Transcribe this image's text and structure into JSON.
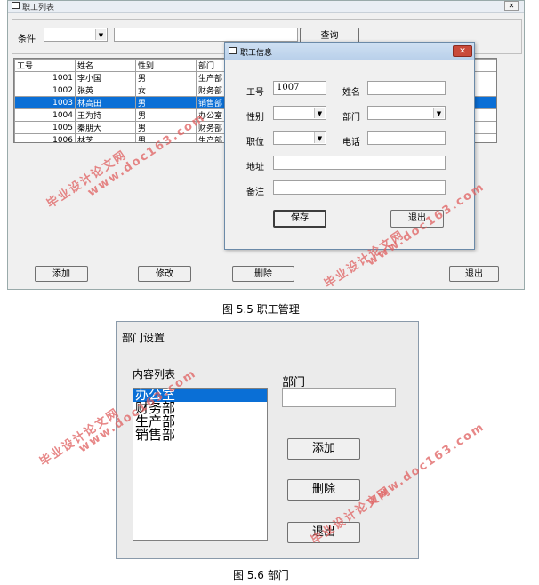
{
  "fig1": {
    "window_title": "职工列表",
    "close_label": "✕",
    "filter": {
      "label": "条件",
      "query_button": "查询",
      "search_value": ""
    },
    "table": {
      "headers": [
        "工号",
        "姓名",
        "性别",
        "部门"
      ],
      "rows": [
        [
          "1001",
          "李小国",
          "男",
          "生产部"
        ],
        [
          "1002",
          "张英",
          "女",
          "财务部"
        ],
        [
          "1003",
          "林高田",
          "男",
          "销售部"
        ],
        [
          "1004",
          "王为持",
          "男",
          "办公室"
        ],
        [
          "1005",
          "秦朋大",
          "男",
          "财务部"
        ],
        [
          "1006",
          "林芝",
          "男",
          "生产部"
        ]
      ],
      "selected_row": 2
    },
    "buttons": {
      "add": "添加",
      "edit": "修改",
      "delete": "删除",
      "exit": "退出"
    },
    "dialog": {
      "title": "职工信息",
      "labels": {
        "id": "工号",
        "name": "姓名",
        "gender": "性别",
        "dept": "部门",
        "position": "职位",
        "phone": "电话",
        "address": "地址",
        "note": "备注"
      },
      "values": {
        "id": "1007",
        "name": "",
        "phone": "",
        "address": "",
        "note": ""
      },
      "save_button": "保存",
      "exit_button": "退出"
    },
    "caption": "图 5.5  职工管理"
  },
  "fig2": {
    "window_title": "部门设置",
    "list_label": "内容列表",
    "list_items": [
      "办公室",
      "财务部",
      "生产部",
      "销售部"
    ],
    "selected_item": 0,
    "dept_label": "部门",
    "dept_value": "",
    "buttons": {
      "add": "添加",
      "delete": "删除",
      "exit": "退出"
    },
    "caption": "图 5.6  部门"
  },
  "watermarks": {
    "cn": "毕业设计论文网",
    "url": "www.doc163.com"
  },
  "colors": {
    "selection": "#0a6fd6",
    "window_bg": "#f0f0f0",
    "watermark": "#e06060",
    "close_red": "#c94a3a"
  }
}
